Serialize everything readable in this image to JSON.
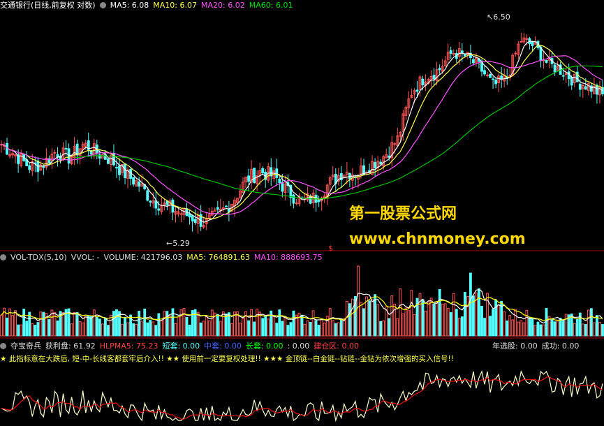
{
  "panel1": {
    "title": "交通银行(日线,前复权 对数)",
    "ma5_label": "MA5: 6.08",
    "ma10_label": "MA10: 6.07",
    "ma20_label": "MA20: 6.02",
    "ma60_label": "MA60: 6.01",
    "high_label": "6.50",
    "low_label": "5.29",
    "dollar_mark": "$"
  },
  "watermark": {
    "line1": "第一股票公式网",
    "line2": "www.chnmoney.com"
  },
  "panel2": {
    "title": "VOL-TDX(5,10)",
    "vvol": "VVOL: -",
    "volume": "VOLUME: 421796.03",
    "ma5": "MA5: 764891.63",
    "ma10": "MA10: 888693.75"
  },
  "panel3": {
    "title": "夺宝奇兵",
    "profit": "获利盘: 61.92",
    "hlpma5": "HLPMA5: 75.23",
    "short": "短套: 0.00",
    "mid": "中套: 0.00",
    "long": "长套: 0.00",
    "colon": ": 0.00",
    "build": "建仓区: 0.00",
    "select": "年选股: 0.00",
    "success": "成功: 0.00",
    "notice": "★ 此指标意在大跌后, 短-中-长线客都套牢后介入!!  ★★ 使用前一定要复权处理!!  ★★★ 金顶链--白金链--钻链--金钻为依次增强的买入信号!!"
  },
  "colors": {
    "up": "#ff5555",
    "down": "#54ffff",
    "ma5": "#ffffff",
    "ma10": "#ffff54",
    "ma20": "#ff54ff",
    "ma60": "#00c000",
    "vol_ma5": "#ffffff",
    "vol_ma10": "#ffff00"
  },
  "chart_data": [
    {
      "type": "candlestick",
      "title": "交通银行(日线,前复权 对数)",
      "annotations": [
        {
          "label": "6.50",
          "kind": "high"
        },
        {
          "label": "5.29",
          "kind": "low"
        }
      ],
      "series": [
        {
          "name": "MA5",
          "value": 6.08
        },
        {
          "name": "MA10",
          "value": 6.07
        },
        {
          "name": "MA20",
          "value": 6.02
        },
        {
          "name": "MA60",
          "value": 6.01
        }
      ],
      "price_range": [
        5.29,
        6.5
      ],
      "trend_closes": [
        5.78,
        5.72,
        5.65,
        5.66,
        5.74,
        5.7,
        5.78,
        5.73,
        5.69,
        5.61,
        5.55,
        5.46,
        5.42,
        5.39,
        5.36,
        5.33,
        5.38,
        5.46,
        5.58,
        5.62,
        5.59,
        5.5,
        5.45,
        5.47,
        5.55,
        5.62,
        5.61,
        5.66,
        5.71,
        5.81,
        6.1,
        6.2,
        6.24,
        6.36,
        6.33,
        6.26,
        6.14,
        6.19,
        6.44,
        6.4,
        6.28,
        6.24,
        6.17,
        6.14,
        6.08
      ]
    },
    {
      "type": "bar",
      "title": "VOL-TDX(5,10)",
      "series": [
        {
          "name": "VOLUME",
          "value": 421796.03
        },
        {
          "name": "MA5",
          "value": 764891.63
        },
        {
          "name": "MA10",
          "value": 888693.75
        }
      ]
    },
    {
      "type": "line",
      "title": "夺宝奇兵",
      "series": [
        {
          "name": "获利盘",
          "value": 61.92
        },
        {
          "name": "HLPMA5",
          "value": 75.23
        }
      ]
    }
  ]
}
